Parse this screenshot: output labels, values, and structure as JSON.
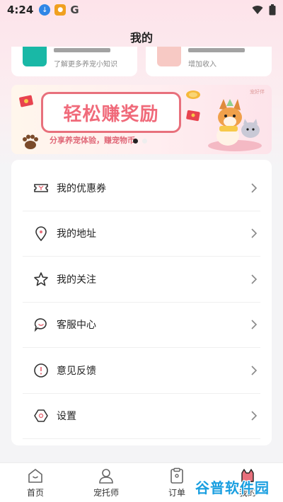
{
  "status_bar": {
    "time": "4:24",
    "g_label": "G"
  },
  "header": {
    "title": "我的"
  },
  "cards": [
    {
      "subtitle": "了解更多养宠小知识",
      "accent": "#19b8a6"
    },
    {
      "subtitle": "增加收入",
      "accent": "#f2a6a6"
    }
  ],
  "banner": {
    "headline": "轻松赚奖励",
    "tagline": "分享养宠体验，赚宠物币",
    "brand": "宠好伴"
  },
  "menu": {
    "items": [
      {
        "label": "我的优惠券",
        "icon": "coupon-icon"
      },
      {
        "label": "我的地址",
        "icon": "location-icon"
      },
      {
        "label": "我的关注",
        "icon": "star-icon"
      },
      {
        "label": "客服中心",
        "icon": "customer-service-icon"
      },
      {
        "label": "意见反馈",
        "icon": "feedback-icon"
      },
      {
        "label": "设置",
        "icon": "settings-icon"
      }
    ]
  },
  "bottom_nav": {
    "items": [
      {
        "label": "首页",
        "icon": "home-icon"
      },
      {
        "label": "宠托师",
        "icon": "sitter-icon"
      },
      {
        "label": "订单",
        "icon": "order-icon"
      },
      {
        "label": "我的",
        "icon": "profile-icon"
      }
    ]
  },
  "watermark": "谷普软件园",
  "colors": {
    "accent_pink": "#f06a7a",
    "background": "#f4f4f6"
  }
}
